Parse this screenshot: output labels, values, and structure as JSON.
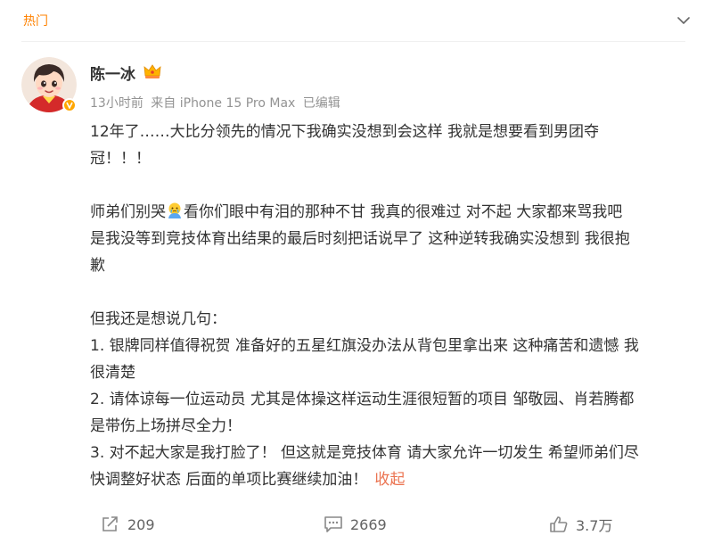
{
  "header": {
    "section_label": "热门"
  },
  "post": {
    "author": "陈一冰",
    "meta": {
      "time": "13小时前",
      "source": "来自 iPhone 15 Pro Max",
      "edited": "已编辑"
    },
    "lines": [
      "12年了……大比分领先的情况下我确实没想到会这样 我就是想要看到男团夺",
      "冠！！！",
      "",
      "师弟们别哭",
      "看你们眼中有泪的那种不甘 我真的很难过 对不起 大家都来骂我吧",
      "是我没等到竞技体育出结果的最后时刻把话说早了 这种逆转我确实没想到 我很抱",
      "歉",
      "",
      "但我还是想说几句：",
      "1. 银牌同样值得祝贺 准备好的五星红旗没办法从背包里拿出来 这种痛苦和遗憾 我",
      "很清楚",
      "2. 请体谅每一位运动员 尤其是体操这样运动生涯很短暂的项目 邹敬园、肖若腾都",
      "是带伤上场拼尽全力！",
      "3. 对不起大家是我打脸了！ 但这就是竞技体育 请大家允许一切发生 希望师弟们尽",
      "快调整好状态 后面的单项比赛继续加油！"
    ],
    "collapse_label": "收起"
  },
  "actions": {
    "share_count": "209",
    "comment_count": "2669",
    "like_count": "3.7万"
  },
  "colors": {
    "hot": "#ff8200",
    "link": "#eb7350",
    "verified": "#ffa600"
  }
}
